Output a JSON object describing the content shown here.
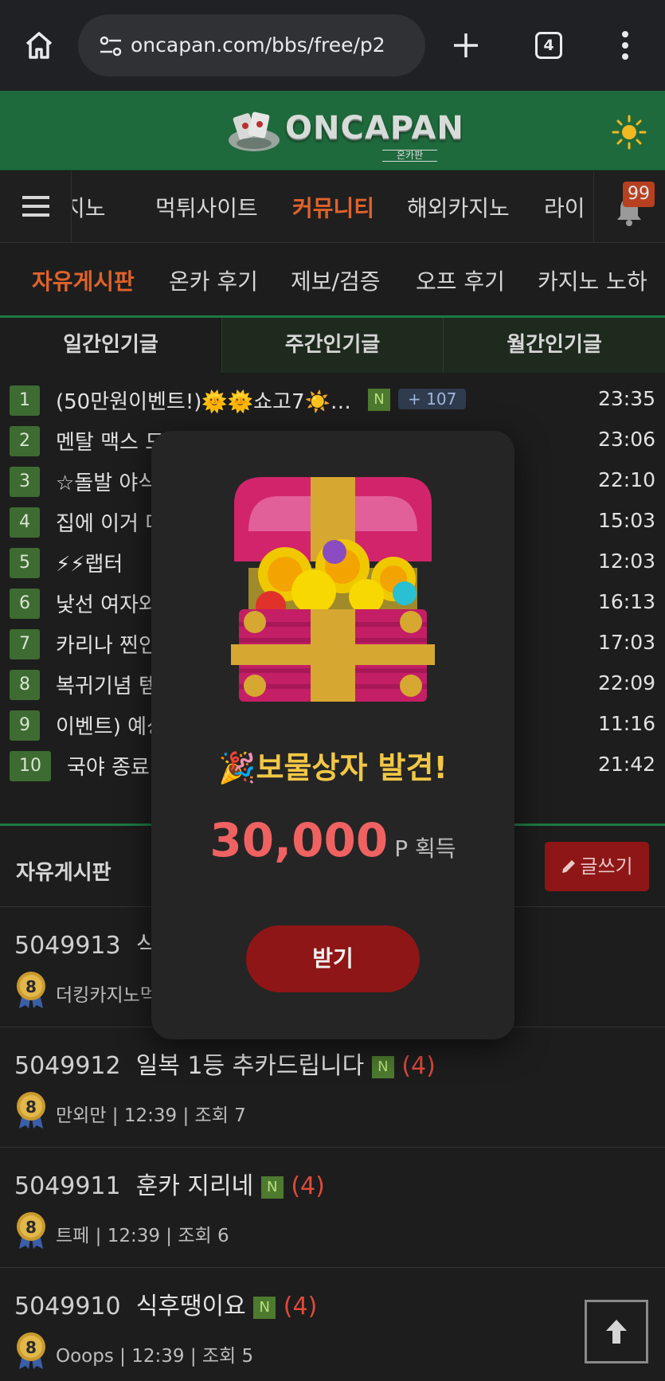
{
  "browser": {
    "url": "oncapan.com/bbs/free/p2",
    "tab_count": "4"
  },
  "site": {
    "logo_text": "ONCAPAN",
    "logo_sub": "온카판"
  },
  "main_nav": {
    "items": [
      "지노",
      "먹튀사이트",
      "커뮤니티",
      "해외카지노",
      "라이"
    ],
    "active": "커뮤니티",
    "notification_count": "99"
  },
  "sub_nav": {
    "items": [
      "자유게시판",
      "온카 후기",
      "제보/검증",
      "오프 후기",
      "카지노 노하"
    ],
    "active": "자유게시판"
  },
  "popular_tabs": [
    "일간인기글",
    "주간인기글",
    "월간인기글"
  ],
  "popular_list": [
    {
      "rank": "1",
      "title": "(50만원이벤트!)🌞🌞쇼고7☀️…",
      "new": "N",
      "count": "+ 107",
      "time": "23:35"
    },
    {
      "rank": "2",
      "title": "멘탈 맥스 도",
      "time": "23:06"
    },
    {
      "rank": "3",
      "title": "☆돌발 야식",
      "time": "22:10"
    },
    {
      "rank": "4",
      "title": "집에 이거 다",
      "time": "15:03"
    },
    {
      "rank": "5",
      "title": "⚡⚡랩터",
      "time": "12:03"
    },
    {
      "rank": "6",
      "title": "낯선 여자와",
      "time": "16:13"
    },
    {
      "rank": "7",
      "title": "카리나 찐인",
      "time": "17:03"
    },
    {
      "rank": "8",
      "title": "복귀기념 템",
      "time": "22:09"
    },
    {
      "rank": "9",
      "title": "이벤트) 예상",
      "time": "11:16"
    },
    {
      "rank": "10",
      "title": "국야 종료",
      "time": "21:42"
    }
  ],
  "board": {
    "title": "자유게시판",
    "write_label": "글쓰기",
    "posts": [
      {
        "num": "5049913",
        "title": "식",
        "new": "",
        "comments": "",
        "author": "더킹카지노먹",
        "time": "",
        "views": ""
      },
      {
        "num": "5049912",
        "title": "일복 1등 추카드립니다",
        "new": "N",
        "comments": "(4)",
        "author": "만외만",
        "time": "12:39",
        "views": "조회 7"
      },
      {
        "num": "5049911",
        "title": "훈카 지리네",
        "new": "N",
        "comments": "(4)",
        "author": "트페",
        "time": "12:39",
        "views": "조회 6"
      },
      {
        "num": "5049910",
        "title": "식후땡이요",
        "new": "N",
        "comments": "(4)",
        "author": "Ooops",
        "time": "12:39",
        "views": "조회 5"
      }
    ],
    "medal_level": "8"
  },
  "modal": {
    "title": "🎉보물상자 발견!",
    "amount": "30,000",
    "unit": "P 획득",
    "claim_label": "받기"
  },
  "colors": {
    "header_green": "#1f6a3d",
    "accent_orange": "#e0622a",
    "button_red": "#8f1616",
    "modal_gold": "#f2c746",
    "amount_red": "#f06262"
  }
}
